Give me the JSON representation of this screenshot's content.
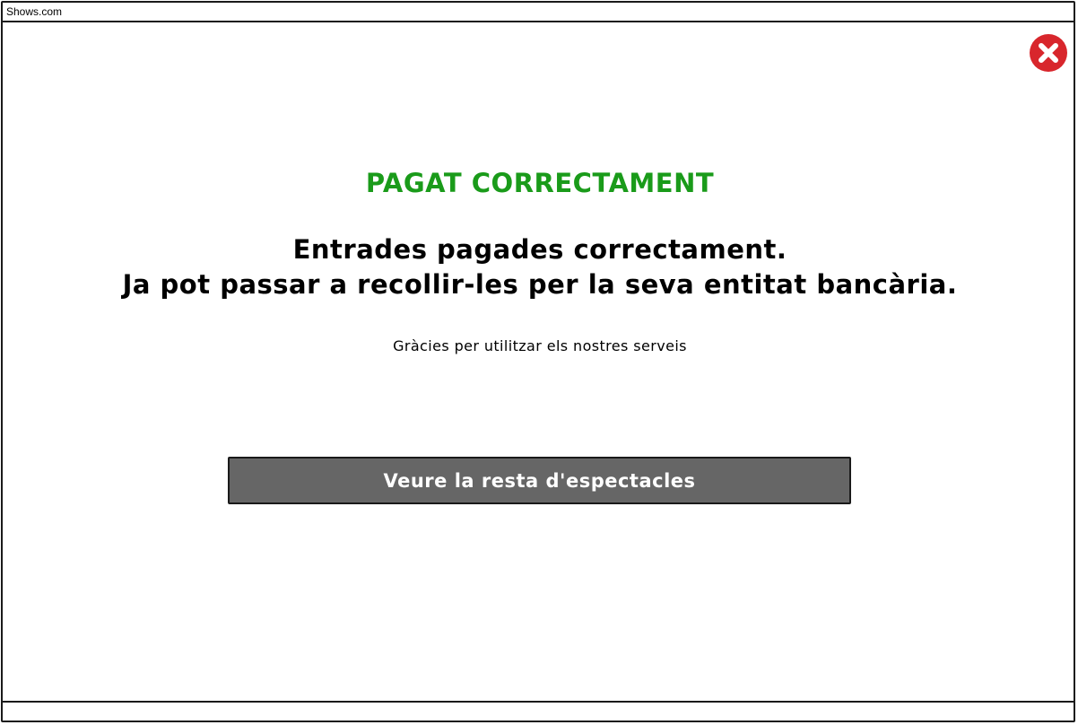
{
  "window": {
    "title": "Shows.com"
  },
  "close_button": {
    "icon": "close-icon",
    "color": "#d8262c"
  },
  "message": {
    "status_title": "PAGAT CORRECTAMENT",
    "status_color": "#1a9b1a",
    "headline_line1": "Entrades pagades correctament.",
    "headline_line2": "Ja pot passar a recollir-les per la seva entitat bancària.",
    "thanks": "Gràcies per utilitzar els nostres serveis"
  },
  "actions": {
    "primary_label": "Veure la resta d'espectacles",
    "primary_bg": "#666666"
  }
}
